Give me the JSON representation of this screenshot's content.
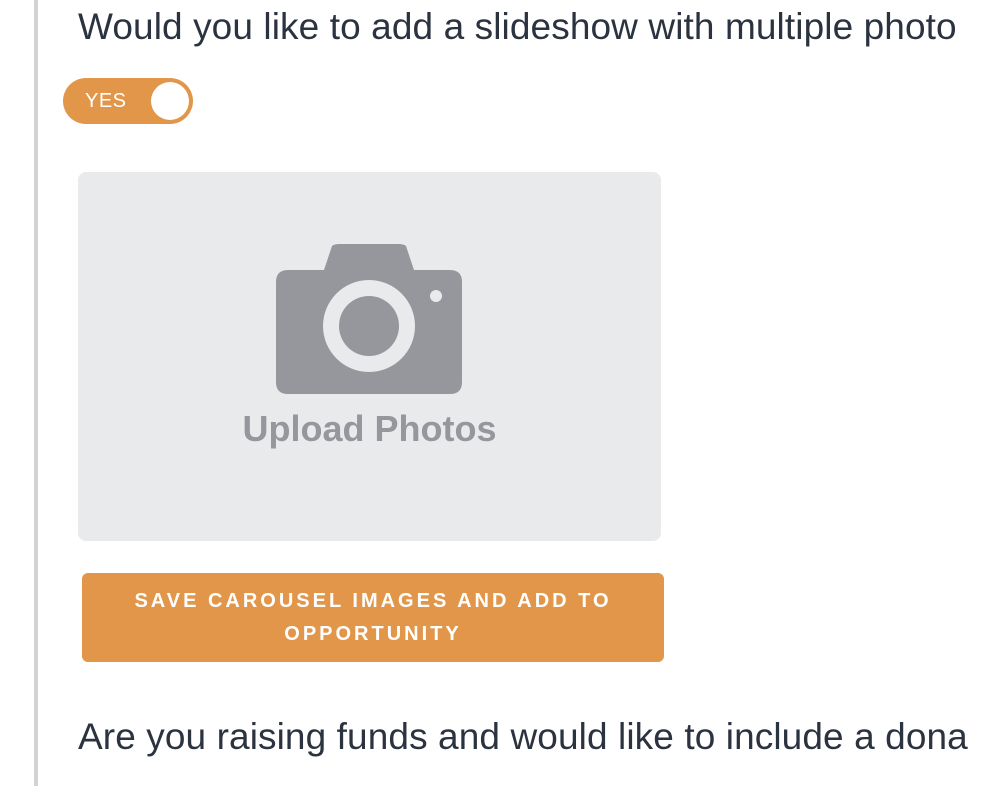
{
  "slideshow_question": {
    "text": "Would you like to add a slideshow with multiple photo"
  },
  "slideshow_toggle": {
    "label": "YES",
    "state": "on",
    "color": "#e2964a"
  },
  "upload_area": {
    "icon": "camera-icon",
    "label": "Upload Photos"
  },
  "save_button": {
    "label": "SAVE CAROUSEL IMAGES AND ADD TO OPPORTUNITY",
    "color": "#e2964a"
  },
  "donation_question": {
    "text": "Are you raising funds and would like to include a dona"
  },
  "colors": {
    "accent": "#e2964a",
    "icon_gray": "#95979c",
    "upload_bg": "#e9eaec"
  }
}
